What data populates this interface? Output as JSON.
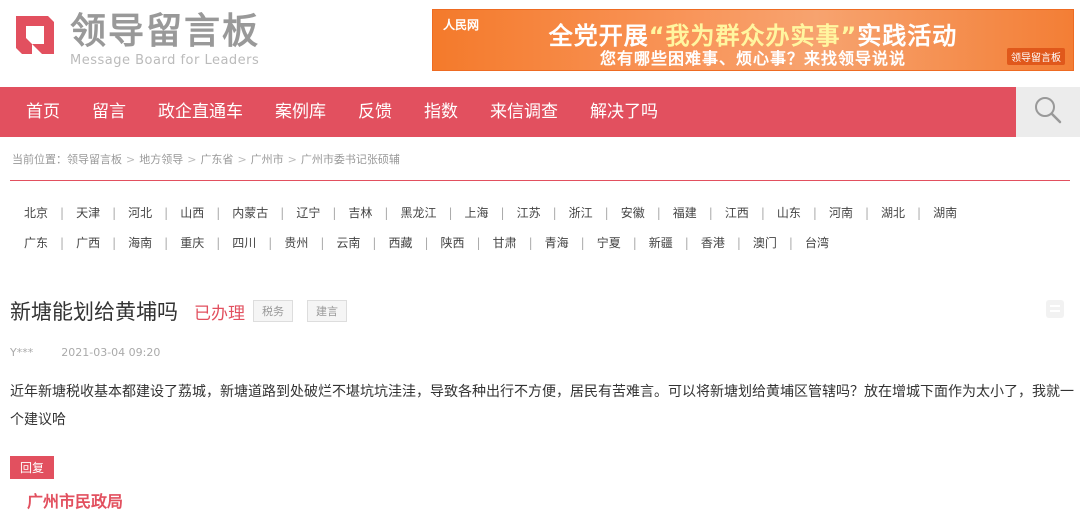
{
  "header": {
    "logo_title": "领导留言板",
    "logo_subtitle": "Message Board for Leaders",
    "brand_color": "#e2505f"
  },
  "banner": {
    "source": "人民网",
    "line1_prefix": "全党开展",
    "line1_highlight": "“我为群众办实事”",
    "line1_suffix": "实践活动",
    "line2": "您有哪些困难事、烦心事？来找领导说说",
    "badge": "领导留言板"
  },
  "nav": {
    "items": [
      "首页",
      "留言",
      "政企直通车",
      "案例库",
      "反馈",
      "指数",
      "来信调查",
      "解决了吗"
    ],
    "search_icon": "search-icon"
  },
  "breadcrumb": {
    "label": "当前位置：",
    "items": [
      "领导留言板",
      "地方领导",
      "广东省",
      "广州市",
      "广州市委书记张硕辅"
    ]
  },
  "provinces": {
    "row1": [
      "北京",
      "天津",
      "河北",
      "山西",
      "内蒙古",
      "辽宁",
      "吉林",
      "黑龙江",
      "上海",
      "江苏",
      "浙江",
      "安徽",
      "福建",
      "江西",
      "山东",
      "河南",
      "湖北",
      "湖南"
    ],
    "row2": [
      "广东",
      "广西",
      "海南",
      "重庆",
      "四川",
      "贵州",
      "云南",
      "西藏",
      "陕西",
      "甘肃",
      "青海",
      "宁夏",
      "新疆",
      "香港",
      "澳门",
      "台湾"
    ]
  },
  "message": {
    "title": "新塘能划给黄埔吗",
    "status": "已办理",
    "tags": [
      "税务",
      "建言"
    ],
    "author": "Y***",
    "date": "2021-03-04 09:20",
    "content": "近年新塘税收基本都建设了荔城，新塘道路到处破烂不堪坑坑洼洼，导致各种出行不方便，居民有苦难言。可以将新塘划给黄埔区管辖吗？放在增城下面作为太小了，我就一个建议哈"
  },
  "reply": {
    "label": "回复",
    "department": "广州市民政局"
  }
}
